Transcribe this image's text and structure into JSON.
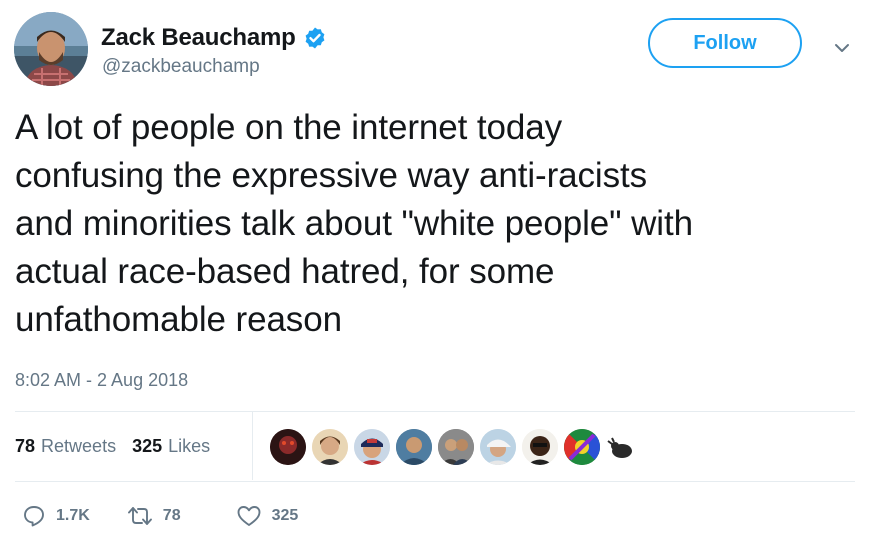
{
  "author": {
    "display_name": "Zack Beauchamp",
    "handle": "@zackbeauchamp",
    "verified": true
  },
  "follow_button": {
    "label": "Follow"
  },
  "tweet": {
    "lines": [
      "A lot of people on the internet today",
      "confusing the expressive way anti-racists",
      "and minorities talk about \"white people\" with",
      "actual race-based hatred, for some",
      "unfathomable reason"
    ],
    "timestamp": "8:02 AM - 2 Aug 2018"
  },
  "stats": {
    "retweets_count": "78",
    "retweets_label": "Retweets",
    "likes_count": "325",
    "likes_label": "Likes"
  },
  "liker_avatars": [
    "avatar-1",
    "avatar-2",
    "avatar-3",
    "avatar-4",
    "avatar-5",
    "avatar-6",
    "avatar-7",
    "avatar-8",
    "avatar-9"
  ],
  "actions": {
    "replies": "1.7K",
    "retweets": "78",
    "likes": "325"
  },
  "colors": {
    "accent": "#1da1f2",
    "text": "#14171a",
    "muted": "#657786",
    "divider": "#e6ecf0"
  }
}
